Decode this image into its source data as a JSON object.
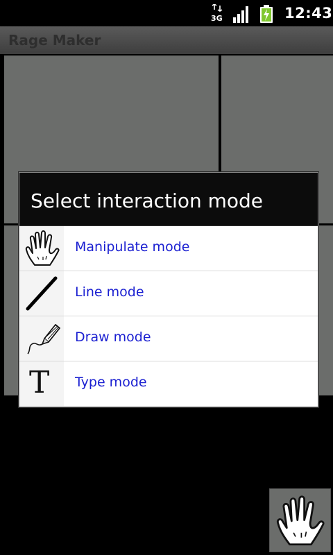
{
  "status_bar": {
    "network": "3G",
    "time": "12:43",
    "battery_color": "#7fc72e"
  },
  "app": {
    "title": "Rage Maker"
  },
  "dialog": {
    "title": "Select interaction mode",
    "items": [
      {
        "label": "Manipulate mode",
        "icon": "hand-icon"
      },
      {
        "label": "Line mode",
        "icon": "line-icon"
      },
      {
        "label": "Draw mode",
        "icon": "pencil-icon"
      },
      {
        "label": "Type mode",
        "icon": "text-icon",
        "glyph": "T"
      }
    ]
  },
  "current_mode": {
    "icon": "hand-icon"
  },
  "colors": {
    "panel": "#6b6d6b",
    "link_text": "#1a1fd1",
    "dialog_header": "#0c0c0c"
  }
}
